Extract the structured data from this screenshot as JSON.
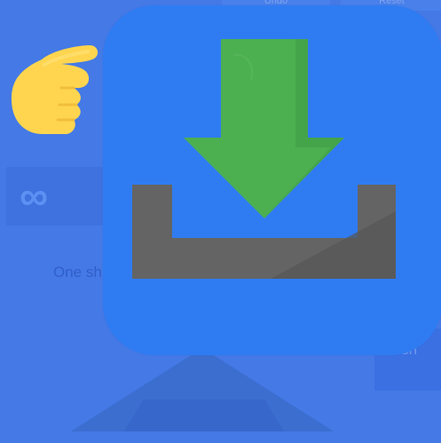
{
  "background": {
    "tabs": [
      "Undo",
      "Reset"
    ],
    "card_icon": "∞",
    "left_caption": "One sh",
    "right_caption": "e sh"
  },
  "icons": {
    "pointer": "pointing-hand-icon",
    "download": "download-tray-icon"
  },
  "colors": {
    "page_background": "#4479e6",
    "tile_background": "#2f7cf2",
    "arrow_green": "#4caf50",
    "tray_gray": "#646464",
    "hand_yellow": "#ffd54f"
  }
}
